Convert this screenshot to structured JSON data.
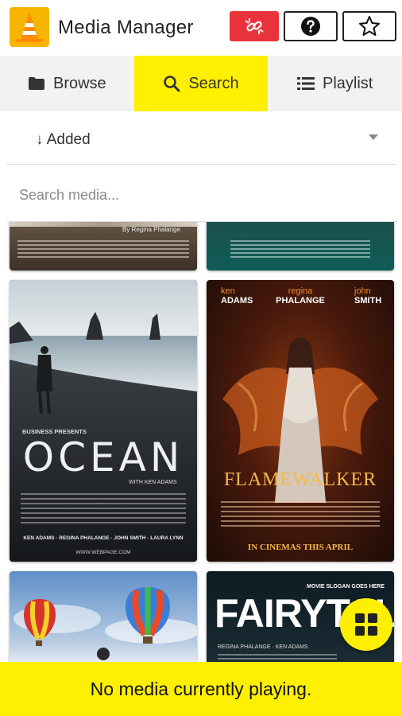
{
  "header": {
    "title": "Media Manager",
    "buttons": [
      "unlink-icon",
      "help-icon",
      "star-icon"
    ],
    "accent": "#e8333a"
  },
  "tabs": [
    {
      "label": "Browse",
      "icon": "folder-icon"
    },
    {
      "label": "Search",
      "icon": "search-icon",
      "active": true
    },
    {
      "label": "Playlist",
      "icon": "list-icon"
    }
  ],
  "sort": {
    "label": "↓ Added"
  },
  "search": {
    "placeholder": "Search media...",
    "value": ""
  },
  "posters": {
    "top_left_byline": "By Regina Phalange",
    "ocean": {
      "presenter": "BUSINESS PRESENTS",
      "title": "OCEAN",
      "with": "WITH KEN ADAMS",
      "credits": "KEN ADAMS · REGINA PHALANGE · JOHN SMITH · LAURA LYNN",
      "url": "WWW.WEBPAGE.COM"
    },
    "flamewalker": {
      "actors": [
        {
          "first": "ken",
          "last": "ADAMS"
        },
        {
          "first": "regina",
          "last": "PHALANGE"
        },
        {
          "first": "john",
          "last": "SMITH"
        }
      ],
      "title": "FLAMEWALKER",
      "tagline": "IN CINEMAS THIS APRIL"
    },
    "fairytale": {
      "slogan": "MOVIE SLOGAN GOES HERE",
      "title": "FAIRYTALE",
      "credits": "REGINA PHALANGE · KEN ADAMS"
    }
  },
  "footer": {
    "status": "No media currently playing."
  },
  "colors": {
    "highlight": "#ffef00",
    "logo": "#f7b500"
  }
}
